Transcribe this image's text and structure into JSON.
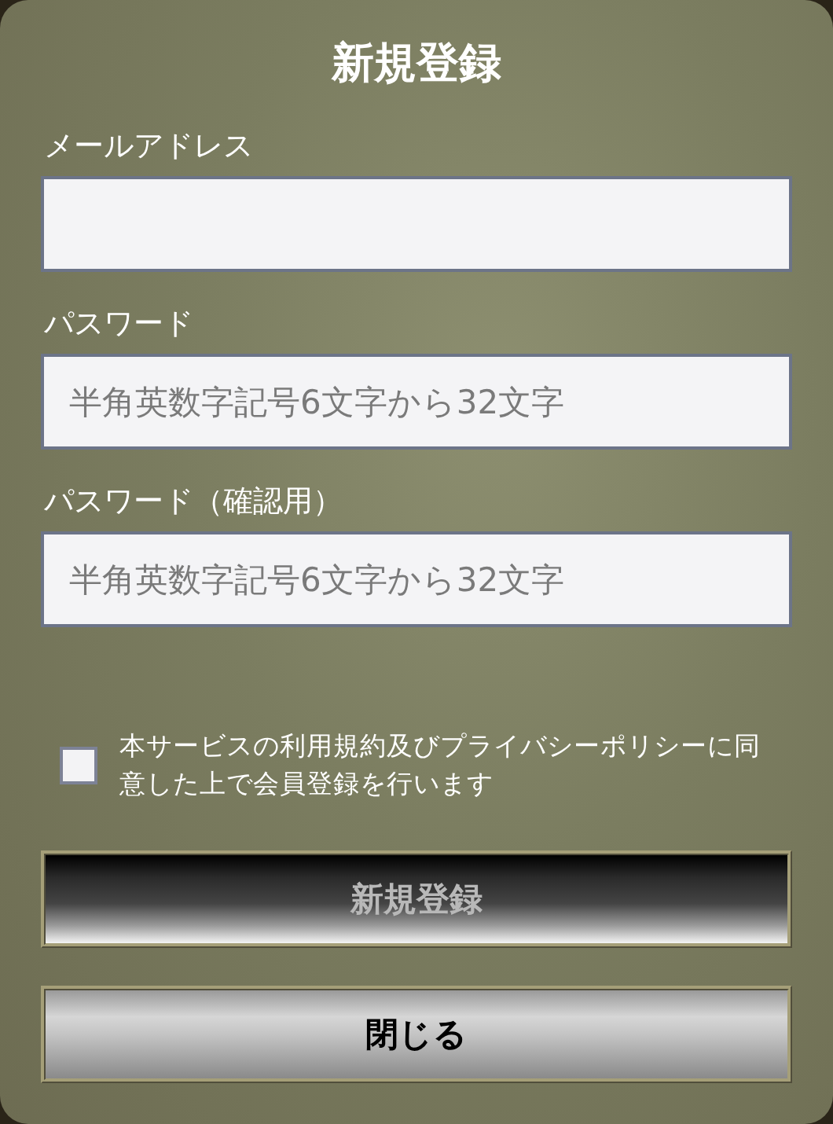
{
  "dialog": {
    "title": "新規登録"
  },
  "fields": [
    {
      "label": "メールアドレス"
    },
    {
      "label": "パスワード",
      "placeholder": "半角英数字記号6文字から32文字"
    },
    {
      "label": "パスワード（確認用）",
      "placeholder": "半角英数字記号6文字から32文字"
    }
  ],
  "agreement": {
    "text": "本サービスの利用規約及びプライバシーポリシーに同意した上で会員登録を行います",
    "checked": false
  },
  "buttons": [
    {
      "label": "新規登録",
      "kind": "submit",
      "disabled": true
    },
    {
      "label": "閉じる",
      "kind": "close",
      "disabled": false
    }
  ]
}
